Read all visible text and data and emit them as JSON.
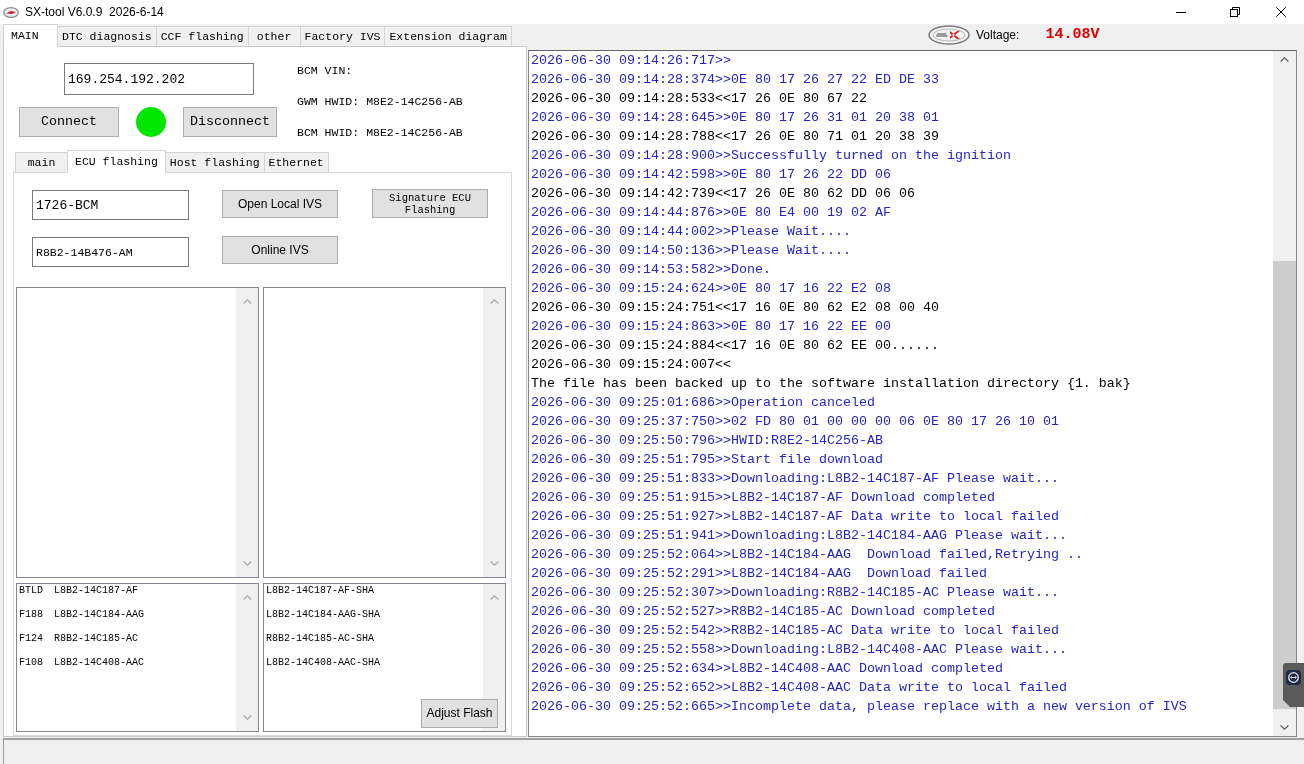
{
  "window": {
    "title": "SX-tool V6.0.9  2026-6-14"
  },
  "tabs": [
    {
      "label": "MAIN",
      "selected": true
    },
    {
      "label": "DTC diagnosis",
      "selected": false
    },
    {
      "label": "CCF flashing",
      "selected": false
    },
    {
      "label": "other",
      "selected": false
    },
    {
      "label": "Factory IVS",
      "selected": false
    },
    {
      "label": "Extension diagram",
      "selected": false
    }
  ],
  "voltage": {
    "label": "Voltage:",
    "value": "14.08V"
  },
  "connection": {
    "ip_address": "169.254.192.202",
    "connect_button": "Connect",
    "connected": true,
    "disconnect_button": "Disconnect"
  },
  "vehicle_info": [
    {
      "label": "BCM VIN:"
    },
    {
      "label": "GWM HWID:",
      "value": "M8E2-14C256-AB"
    },
    {
      "label": "BCM HWID:",
      "value": "M8E2-14C256-AB"
    }
  ],
  "sub_tabs": [
    {
      "label": "main",
      "selected": false
    },
    {
      "label": "ECU flashing",
      "selected": true
    },
    {
      "label": "Host flashing",
      "selected": false
    },
    {
      "label": "Ethernet",
      "selected": false
    }
  ],
  "ecu_flashing": {
    "module_field": {
      "value": "1726-BCM"
    },
    "part_field": {
      "value": "R8B2-14B476-AM"
    },
    "open_local_button": "Open Local IVS",
    "signature_button": "Signature ECU Flashing",
    "online_button": "Online IVS",
    "block_list": [
      {
        "code": "BTLD",
        "part_number": "L8B2-14C187-AF",
        "selected": false
      },
      {
        "code": "F188",
        "part_number": "L8B2-14C184-AAG",
        "selected": false
      },
      {
        "code": "F124",
        "part_number": "R8B2-14C185-AC",
        "selected": false
      },
      {
        "code": "F108",
        "part_number": "L8B2-14C408-AAC",
        "selected": false
      }
    ],
    "signature_list": [
      {
        "text": "L8B2-14C187-AF-SHA",
        "selected": false
      },
      {
        "text": "L8B2-14C184-AAG-SHA",
        "selected": false
      },
      {
        "text": "R8B2-14C185-AC-SHA",
        "selected": false
      },
      {
        "text": "L8B2-14C408-AAC-SHA",
        "selected": false
      }
    ],
    "adjust_button": "Adjust Flash"
  },
  "log": [
    {
      "kind": "sent",
      "text": "2026-06-30 09:14:26:717>>"
    },
    {
      "kind": "sent",
      "text": "2026-06-30 09:14:28:374>>0E 80 17 26 27 22 ED DE 33"
    },
    {
      "kind": "received",
      "text": "2026-06-30 09:14:28:533<<17 26 0E 80 67 22"
    },
    {
      "kind": "sent",
      "text": "2026-06-30 09:14:28:645>>0E 80 17 26 31 01 20 38 01"
    },
    {
      "kind": "received",
      "text": "2026-06-30 09:14:28:788<<17 26 0E 80 71 01 20 38 39"
    },
    {
      "kind": "sent",
      "text": "2026-06-30 09:14:28:900>>Successfully turned on the ignition"
    },
    {
      "kind": "sent",
      "text": "2026-06-30 09:14:42:598>>0E 80 17 26 22 DD 06"
    },
    {
      "kind": "received",
      "text": "2026-06-30 09:14:42:739<<17 26 0E 80 62 DD 06 06"
    },
    {
      "kind": "sent",
      "text": "2026-06-30 09:14:44:876>>0E 80 E4 00 19 02 AF"
    },
    {
      "kind": "sent",
      "text": "2026-06-30 09:14:44:002>>Please Wait...."
    },
    {
      "kind": "sent",
      "text": "2026-06-30 09:14:50:136>>Please Wait...."
    },
    {
      "kind": "sent",
      "text": "2026-06-30 09:14:53:582>>Done."
    },
    {
      "kind": "sent",
      "text": "2026-06-30 09:15:24:624>>0E 80 17 16 22 E2 08"
    },
    {
      "kind": "received",
      "text": "2026-06-30 09:15:24:751<<17 16 0E 80 62 E2 08 00 40"
    },
    {
      "kind": "sent",
      "text": "2026-06-30 09:15:24:863>>0E 80 17 16 22 EE 00"
    },
    {
      "kind": "received",
      "text": "2026-06-30 09:15:24:884<<17 16 0E 80 62 EE 00......"
    },
    {
      "kind": "received",
      "text": "2026-06-30 09:15:24:007<<"
    },
    {
      "kind": "info",
      "text": "The file has been backed up to the software installation directory {1. bak}"
    },
    {
      "kind": "sent",
      "text": "2026-06-30 09:25:01:686>>Operation canceled"
    },
    {
      "kind": "sent",
      "text": "2026-06-30 09:25:37:750>>02 FD 80 01 00 00 00 06 0E 80 17 26 10 01"
    },
    {
      "kind": "sent",
      "text": "2026-06-30 09:25:50:796>>HWID:R8E2-14C256-AB"
    },
    {
      "kind": "sent",
      "text": "2026-06-30 09:25:51:795>>Start file download"
    },
    {
      "kind": "sent",
      "text": "2026-06-30 09:25:51:833>>Downloading:L8B2-14C187-AF Please wait..."
    },
    {
      "kind": "sent",
      "text": "2026-06-30 09:25:51:915>>L8B2-14C187-AF Download completed"
    },
    {
      "kind": "sent",
      "text": "2026-06-30 09:25:51:927>>L8B2-14C187-AF Data write to local failed"
    },
    {
      "kind": "sent",
      "text": "2026-06-30 09:25:51:941>>Downloading:L8B2-14C184-AAG Please wait..."
    },
    {
      "kind": "sent",
      "text": "2026-06-30 09:25:52:064>>L8B2-14C184-AAG  Download failed,Retrying .."
    },
    {
      "kind": "sent",
      "text": "2026-06-30 09:25:52:291>>L8B2-14C184-AAG  Download failed"
    },
    {
      "kind": "sent",
      "text": "2026-06-30 09:25:52:307>>Downloading:R8B2-14C185-AC Please wait..."
    },
    {
      "kind": "sent",
      "text": "2026-06-30 09:25:52:527>>R8B2-14C185-AC Download completed"
    },
    {
      "kind": "sent",
      "text": "2026-06-30 09:25:52:542>>R8B2-14C185-AC Data write to local failed"
    },
    {
      "kind": "sent",
      "text": "2026-06-30 09:25:52:558>>Downloading:L8B2-14C408-AAC Please wait..."
    },
    {
      "kind": "sent",
      "text": "2026-06-30 09:25:52:634>>L8B2-14C408-AAC Download completed"
    },
    {
      "kind": "sent",
      "text": "2026-06-30 09:25:52:652>>L8B2-14C408-AAC Data write to local failed"
    },
    {
      "kind": "sent",
      "text": "2026-06-30 09:25:52:665>>Incomplete data, please replace with a new version of IVS"
    }
  ]
}
